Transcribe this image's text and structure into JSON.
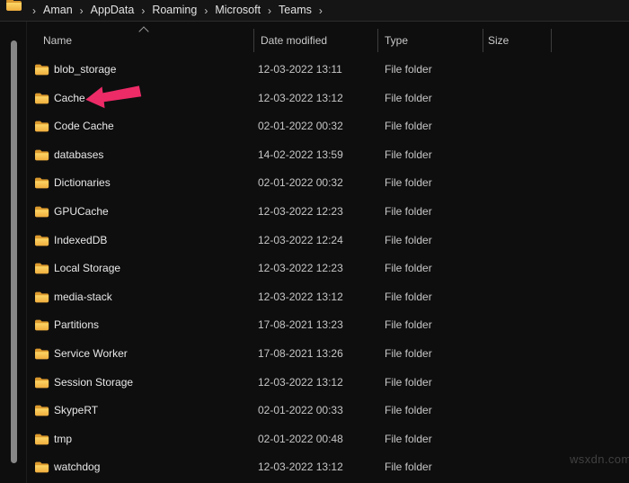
{
  "breadcrumb": {
    "items": [
      "Aman",
      "AppData",
      "Roaming",
      "Microsoft",
      "Teams"
    ]
  },
  "icons": {
    "breadcrumb_chevron": "›",
    "folder_icon": "folder",
    "sort_ascending_icon": "chevron-up"
  },
  "columns": {
    "name": "Name",
    "date_modified": "Date modified",
    "type": "Type",
    "size": "Size"
  },
  "rows": [
    {
      "name": "blob_storage",
      "date": "12-03-2022 13:11",
      "type": "File folder",
      "size": ""
    },
    {
      "name": "Cache",
      "date": "12-03-2022 13:12",
      "type": "File folder",
      "size": ""
    },
    {
      "name": "Code Cache",
      "date": "02-01-2022 00:32",
      "type": "File folder",
      "size": ""
    },
    {
      "name": "databases",
      "date": "14-02-2022 13:59",
      "type": "File folder",
      "size": ""
    },
    {
      "name": "Dictionaries",
      "date": "02-01-2022 00:32",
      "type": "File folder",
      "size": ""
    },
    {
      "name": "GPUCache",
      "date": "12-03-2022 12:23",
      "type": "File folder",
      "size": ""
    },
    {
      "name": "IndexedDB",
      "date": "12-03-2022 12:24",
      "type": "File folder",
      "size": ""
    },
    {
      "name": "Local Storage",
      "date": "12-03-2022 12:23",
      "type": "File folder",
      "size": ""
    },
    {
      "name": "media-stack",
      "date": "12-03-2022 13:12",
      "type": "File folder",
      "size": ""
    },
    {
      "name": "Partitions",
      "date": "17-08-2021 13:23",
      "type": "File folder",
      "size": ""
    },
    {
      "name": "Service Worker",
      "date": "17-08-2021 13:26",
      "type": "File folder",
      "size": ""
    },
    {
      "name": "Session Storage",
      "date": "12-03-2022 13:12",
      "type": "File folder",
      "size": ""
    },
    {
      "name": "SkypeRT",
      "date": "02-01-2022 00:33",
      "type": "File folder",
      "size": ""
    },
    {
      "name": "tmp",
      "date": "02-01-2022 00:48",
      "type": "File folder",
      "size": ""
    },
    {
      "name": "watchdog",
      "date": "12-03-2022 13:12",
      "type": "File folder",
      "size": ""
    }
  ],
  "annotation": {
    "shape": "arrow-left",
    "color": "#ed2b67",
    "points_to_row": "Cache"
  },
  "watermark": "wsxdn.com",
  "colors": {
    "accent_pink": "#ed2b67",
    "folder_yellow": "#f5b73d",
    "background": "#0e0e0f"
  }
}
